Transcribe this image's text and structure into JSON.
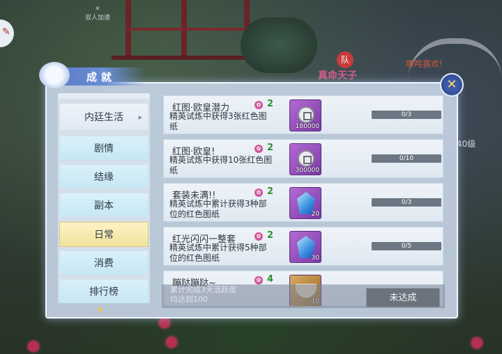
{
  "scene": {
    "top_icon_label": "双人加速",
    "left_badge": "✎",
    "nameplate": "真命天子",
    "emblem": "队",
    "other_player_name": "哪咤喜欢!",
    "level_text": "40级"
  },
  "window": {
    "title": "成就",
    "close_icon": "close-icon"
  },
  "sidebar": {
    "parent": {
      "label": "内廷生活",
      "arrow": "▸"
    },
    "items": [
      {
        "label": "剧情"
      },
      {
        "label": "结缘"
      },
      {
        "label": "副本"
      },
      {
        "label": "日常",
        "active": true
      },
      {
        "label": "消费"
      },
      {
        "label": "排行榜"
      }
    ],
    "scroll_down": "▾"
  },
  "achievements": [
    {
      "name": "红图·欧皇潜力",
      "desc": "精英试炼中获得3张红色图纸",
      "points": "2",
      "reward": {
        "type": "coin",
        "qty": "180000"
      },
      "progress": {
        "text": "0/3",
        "ratio": 0
      }
    },
    {
      "name": "红图·欧皇!",
      "desc": "精英试炼中获得10张红色图纸",
      "points": "2",
      "reward": {
        "type": "coin",
        "qty": "300000"
      },
      "progress": {
        "text": "0/10",
        "ratio": 0
      }
    },
    {
      "name": "套装未满!!",
      "desc": "精英试炼中累计获得3种部位的红色图纸",
      "points": "2",
      "reward": {
        "type": "gem",
        "qty": "20"
      },
      "progress": {
        "text": "0/3",
        "ratio": 0
      }
    },
    {
      "name": "红光闪闪一整套",
      "desc": "精英试炼中累计获得5种部位的红色图纸",
      "points": "2",
      "reward": {
        "type": "gem",
        "qty": "30"
      },
      "progress": {
        "text": "0/5",
        "ratio": 0
      }
    },
    {
      "name": "蹦跶蹦跶~",
      "desc": "",
      "points": "4",
      "reward": {
        "type": "bowl",
        "qty": "10"
      },
      "progress": null
    }
  ],
  "tooltip": {
    "text": "累计完成3天活跃度均达到100",
    "status_button": "未达成"
  }
}
